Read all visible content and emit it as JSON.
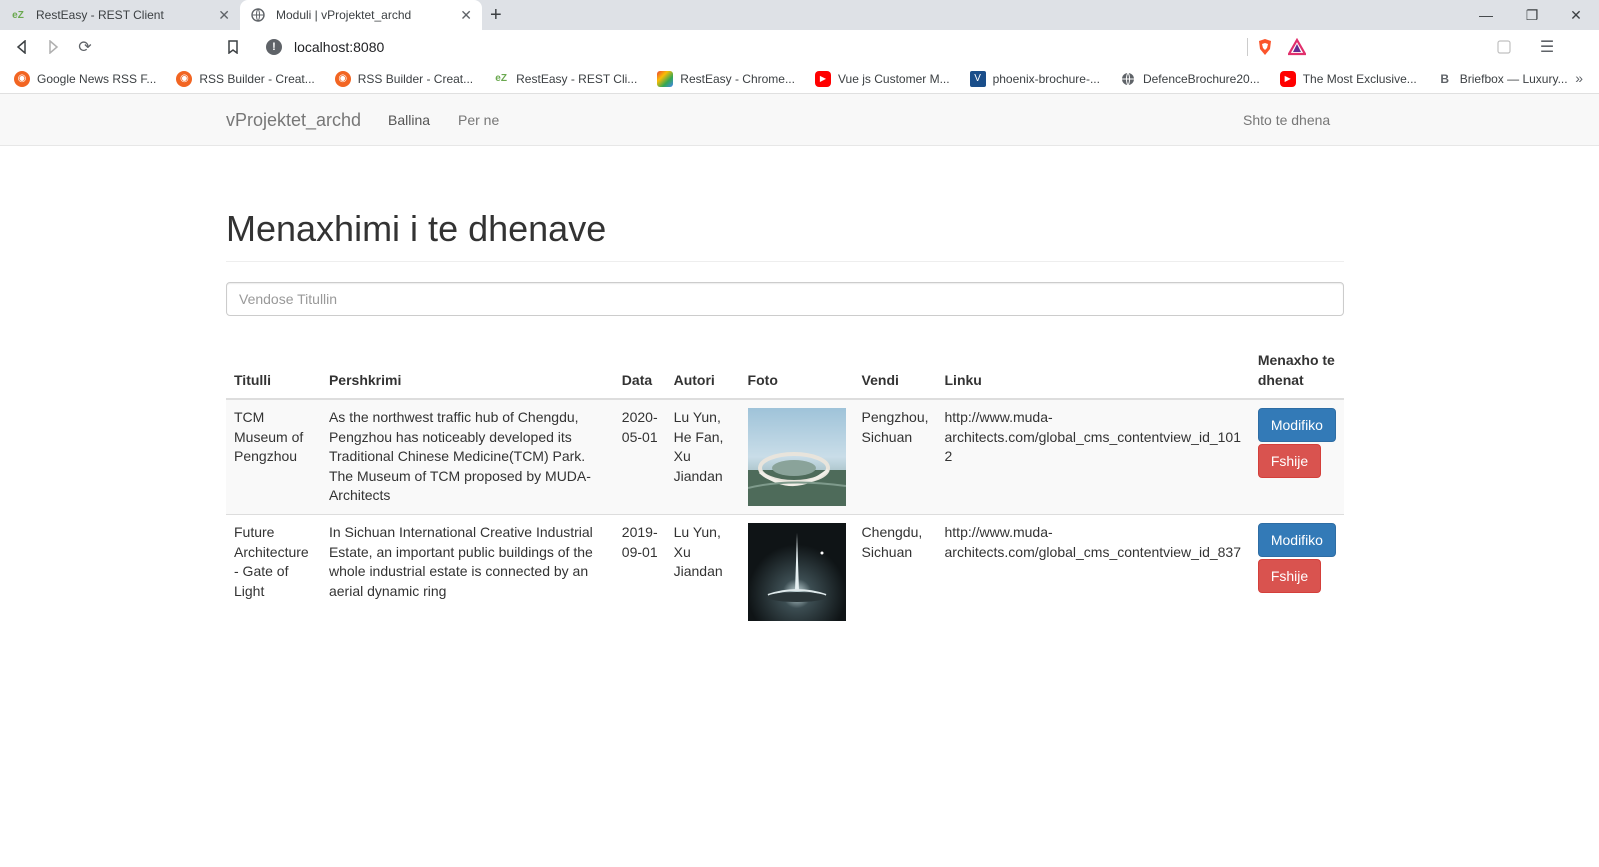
{
  "browser": {
    "tabs": [
      {
        "title": "RestEasy - REST Client",
        "icon": "resteasy-icon"
      },
      {
        "title": "Moduli | vProjektet_archd",
        "icon": "globe-icon"
      }
    ],
    "address": "localhost:8080",
    "bookmarks": [
      {
        "label": "Google News RSS F...",
        "icon": "rss-icon"
      },
      {
        "label": "RSS Builder - Creat...",
        "icon": "rss-icon"
      },
      {
        "label": "RSS Builder - Creat...",
        "icon": "rss-icon"
      },
      {
        "label": "RestEasy - REST Cli...",
        "icon": "resteasy-icon"
      },
      {
        "label": "RestEasy - Chrome...",
        "icon": "rainbow-icon"
      },
      {
        "label": "Vue js Customer M...",
        "icon": "youtube-icon"
      },
      {
        "label": "phoenix-brochure-...",
        "icon": "v-logo-icon"
      },
      {
        "label": "DefenceBrochure20...",
        "icon": "globe-icon"
      },
      {
        "label": "The Most Exclusive...",
        "icon": "youtube-icon"
      },
      {
        "label": "Briefbox — Luxury...",
        "icon": "b-logo-icon"
      }
    ]
  },
  "navbar": {
    "brand": "vProjektet_archd",
    "links": [
      "Ballina",
      "Per ne"
    ],
    "right_link": "Shto te dhena"
  },
  "main": {
    "title": "Menaxhimi i te dhenave",
    "search_placeholder": "Vendose Titullin",
    "table": {
      "headers": [
        "Titulli",
        "Pershkrimi",
        "Data",
        "Autori",
        "Foto",
        "Vendi",
        "Linku",
        "Menaxho te dhenat"
      ],
      "rows": [
        {
          "title": "TCM Museum of Pengzhou",
          "description": "As the northwest traffic hub of Chengdu, Pengzhou has noticeably developed its Traditional Chinese Medicine(TCM) Park. The Museum of TCM proposed by MUDA-Architects",
          "date": "2020-05-01",
          "author": "Lu Yun, He Fan, Xu Jiandan",
          "place": "Pengzhou, Sichuan",
          "link": "http://www.muda-architects.com/global_cms_contentview_id_1012",
          "edit": "Modifiko",
          "delete": "Fshije"
        },
        {
          "title": "Future Architecture - Gate of Light",
          "description": "In Sichuan International Creative Industrial Estate, an important public buildings of the whole industrial estate is connected by an aerial dynamic ring",
          "date": "2019-09-01",
          "author": "Lu Yun, Xu Jiandan",
          "place": "Chengdu, Sichuan",
          "link": "http://www.muda-architects.com/global_cms_contentview_id_837",
          "edit": "Modifiko",
          "delete": "Fshije"
        }
      ]
    }
  }
}
